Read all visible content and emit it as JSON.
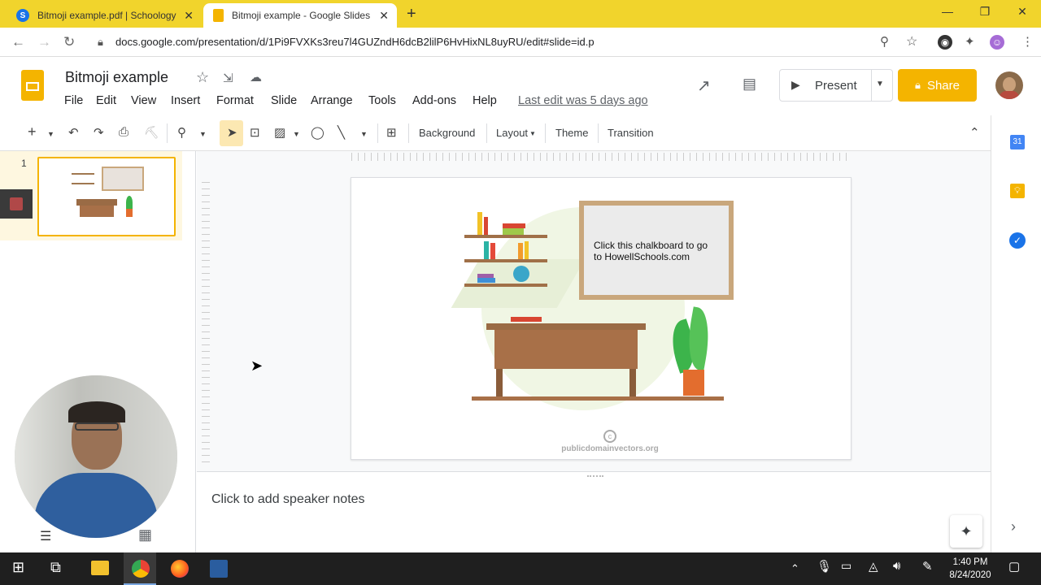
{
  "browser": {
    "tabs": [
      {
        "title": "Bitmoji example.pdf | Schoology",
        "active": false,
        "icon": "schoology-icon"
      },
      {
        "title": "Bitmoji example - Google Slides",
        "active": true,
        "icon": "slides-icon"
      }
    ],
    "url": "docs.google.com/presentation/d/1Pi9FVXKs3reu7l4GUZndH6dcB2lilP6HvHixNL8uyRU/edit#slide=id.p"
  },
  "app": {
    "doc_title": "Bitmoji example",
    "menu": [
      "File",
      "Edit",
      "View",
      "Insert",
      "Format",
      "Slide",
      "Arrange",
      "Tools",
      "Add-ons",
      "Help"
    ],
    "last_edit": "Last edit was 5 days ago",
    "present_label": "Present",
    "share_label": "Share"
  },
  "toolbar": {
    "background_label": "Background",
    "layout_label": "Layout",
    "theme_label": "Theme",
    "transition_label": "Transition"
  },
  "filmstrip": {
    "slide_number": "1"
  },
  "slide": {
    "chalkboard_text": "Click this chalkboard to go to HowellSchools.com",
    "watermark": "publicdomainvectors.org"
  },
  "notes": {
    "placeholder": "Click to add speaker notes"
  },
  "taskbar": {
    "time": "1:40 PM",
    "date": "8/24/2020"
  },
  "colors": {
    "tabbar": "#f1d42c",
    "share": "#f4b400",
    "slides_brand": "#f4b400"
  }
}
